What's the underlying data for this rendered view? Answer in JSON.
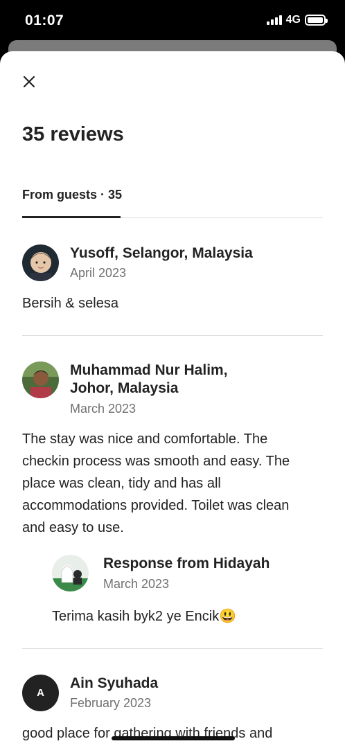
{
  "status_bar": {
    "time": "01:07",
    "network": "4G"
  },
  "title": "35 reviews",
  "tabs": [
    {
      "label": "From guests · 35",
      "active": true
    }
  ],
  "reviews": [
    {
      "name": "Yusoff, Selangor, Malaysia",
      "date": "April 2023",
      "text": "Bersih & selesa",
      "avatar": "user-photo-child"
    },
    {
      "name_line1": "Muhammad Nur Halim,",
      "name_line2": "Johor, Malaysia",
      "date": "March 2023",
      "text_lines": [
        "The stay was nice and comfortable. The",
        "checkin process was smooth and easy. The",
        "place was clean, tidy and has all",
        "accommodations provided. Toilet was clean",
        "and easy to use."
      ],
      "avatar": "user-photo-man",
      "response": {
        "title": "Response from Hidayah",
        "date": "March 2023",
        "text": "Terima kasih byk2 ye Encik😃",
        "avatar": "host-photo"
      }
    },
    {
      "name": "Ain Syuhada",
      "date": "February 2023",
      "avatar_letter": "A",
      "text": "good place for gathering with friends and"
    }
  ],
  "colors": {
    "text": "#222222",
    "secondary": "#717171",
    "divider": "#dddddd"
  }
}
